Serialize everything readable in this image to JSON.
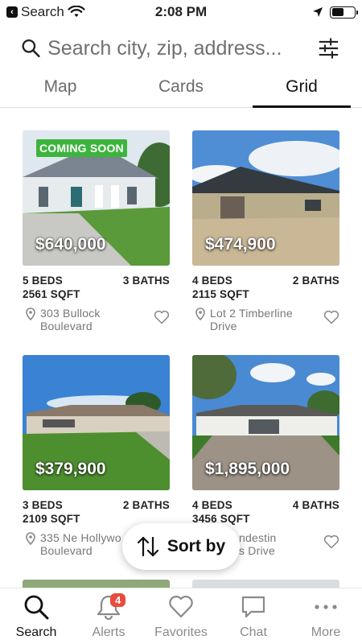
{
  "status_bar": {
    "back_app": "Search",
    "time": "2:08 PM",
    "battery_level": 0.55
  },
  "search": {
    "placeholder": "Search city, zip, address..."
  },
  "tabs": [
    {
      "label": "Map",
      "active": false
    },
    {
      "label": "Cards",
      "active": false
    },
    {
      "label": "Grid",
      "active": true
    }
  ],
  "listings": [
    {
      "price": "$640,000",
      "beds": "5 BEDS",
      "baths": "3 BATHS",
      "sqft": "2561 SQFT",
      "address_line1": "303 Bullock",
      "address_line2": "Boulevard",
      "badge": "COMING SOON"
    },
    {
      "price": "$474,900",
      "beds": "4 BEDS",
      "baths": "2 BATHS",
      "sqft": "2115 SQFT",
      "address_line1": "Lot 2 Timberline",
      "address_line2": "Drive",
      "badge": ""
    },
    {
      "price": "$379,900",
      "beds": "3 BEDS",
      "baths": "2 BATHS",
      "sqft": "2109 SQFT",
      "address_line1": "335 Ne Hollywo",
      "address_line2": "Boulevard",
      "badge": ""
    },
    {
      "price": "$1,895,000",
      "beds": "4 BEDS",
      "baths": "4 BATHS",
      "sqft": "3456 SQFT",
      "address_line1": "ndestin",
      "address_line2": "s Drive",
      "badge": ""
    }
  ],
  "sort_button": {
    "label": "Sort by"
  },
  "bottom_nav": [
    {
      "label": "Search",
      "icon": "search-icon",
      "active": true
    },
    {
      "label": "Alerts",
      "icon": "bell-icon",
      "badge": "4"
    },
    {
      "label": "Favorites",
      "icon": "heart-icon"
    },
    {
      "label": "Chat",
      "icon": "chat-icon"
    },
    {
      "label": "More",
      "icon": "more-icon"
    }
  ],
  "colors": {
    "badge_green": "#3cb53c",
    "alert_red": "#e74c3c",
    "active": "#111111",
    "inactive": "#8a8a8a"
  }
}
